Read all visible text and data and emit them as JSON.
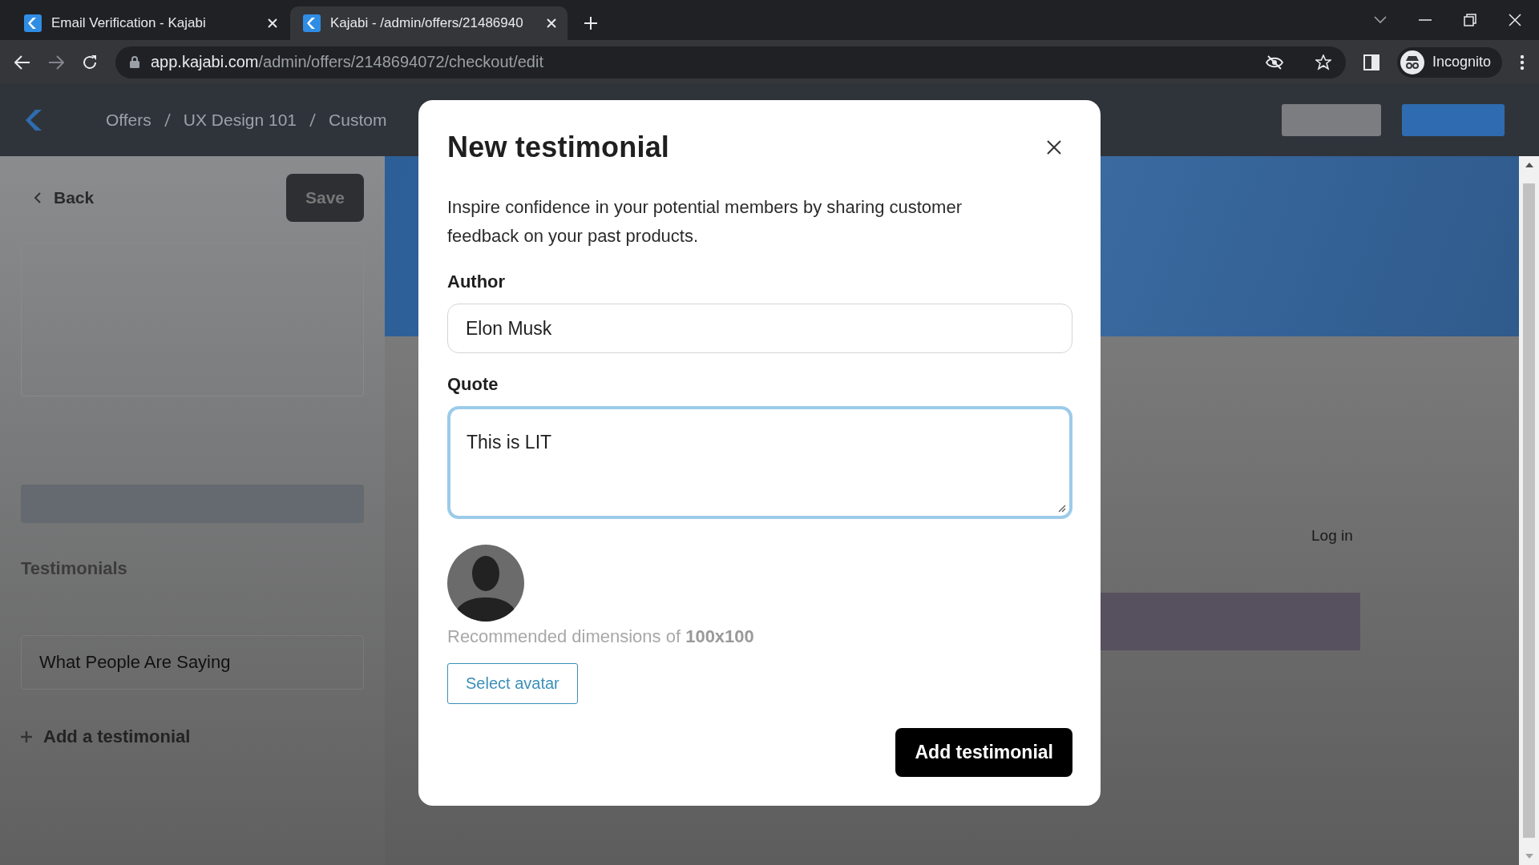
{
  "browser": {
    "tabs": [
      {
        "title": "Email Verification - Kajabi",
        "selected": false
      },
      {
        "title": "Kajabi - /admin/offers/21486940",
        "selected": true
      }
    ],
    "url_host": "app.kajabi.com",
    "url_path": "/admin/offers/2148694072/checkout/edit",
    "profile": "Incognito"
  },
  "header": {
    "breadcrumbs": [
      "Offers",
      "UX Design 101",
      "Custom"
    ]
  },
  "sidebar": {
    "back": "Back",
    "save": "Save",
    "section_title": "Testimonials",
    "testimonial": "What People Are Saying",
    "add": "Add a testimonial"
  },
  "preview": {
    "link": "Log in"
  },
  "dialog": {
    "title": "New testimonial",
    "description": "Inspire confidence in your potential members by sharing customer feedback on your past products.",
    "fields": [
      {
        "label": "Author",
        "kind": "input",
        "value": "Elon Musk",
        "focused": false
      },
      {
        "label": "Quote",
        "kind": "textarea",
        "value": "This is LIT",
        "focused": true
      }
    ],
    "avatar_hint": "Recommended dimensions of **100x100**",
    "avatar_button": "Select avatar",
    "submit": "Add testimonial"
  }
}
